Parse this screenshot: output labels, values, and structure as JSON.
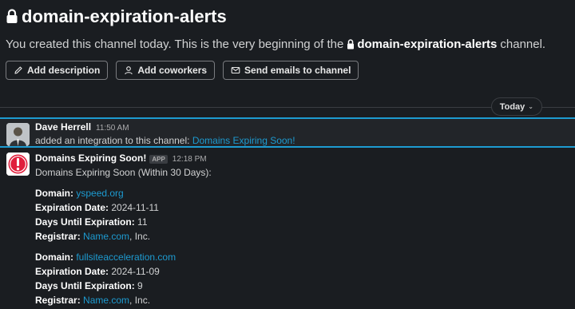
{
  "channel": {
    "title": "domain-expiration-alerts",
    "intro_prefix": "You created this channel today. This is the very beginning of the",
    "intro_name": "domain-expiration-alerts",
    "intro_suffix": "channel."
  },
  "actions": {
    "add_description": "Add description",
    "add_coworkers": "Add coworkers",
    "send_emails": "Send emails to channel"
  },
  "date_divider": "Today",
  "messages": [
    {
      "author": "Dave Herrell",
      "time": "11:50 AM",
      "text_prefix": "added an integration to this channel:",
      "link": "Domains Expiring Soon!"
    },
    {
      "author": "Domains Expiring Soon!",
      "badge": "APP",
      "time": "12:18 PM",
      "heading": "Domains Expiring Soon (Within 30 Days):",
      "domains": [
        {
          "domain_label": "Domain:",
          "domain": "yspeed.org",
          "exp_label": "Expiration Date:",
          "exp": "2024-11-11",
          "days_label": "Days Until Expiration:",
          "days": "11",
          "reg_label": "Registrar:",
          "reg_link": "Name.com",
          "reg_suffix": ", Inc."
        },
        {
          "domain_label": "Domain:",
          "domain": "fullsiteacceleration.com",
          "exp_label": "Expiration Date:",
          "exp": "2024-11-09",
          "days_label": "Days Until Expiration:",
          "days": "9",
          "reg_label": "Registrar:",
          "reg_link": "Name.com",
          "reg_suffix": ", Inc."
        }
      ]
    }
  ],
  "colors": {
    "background": "#1a1d21",
    "link": "#1d9bd1",
    "highlight_border": "#1d9bd1",
    "alert_red": "#e01e3c"
  },
  "icons": [
    "lock-icon",
    "pencil-icon",
    "add-person-icon",
    "mail-icon",
    "chevron-down-icon",
    "alert-icon"
  ]
}
